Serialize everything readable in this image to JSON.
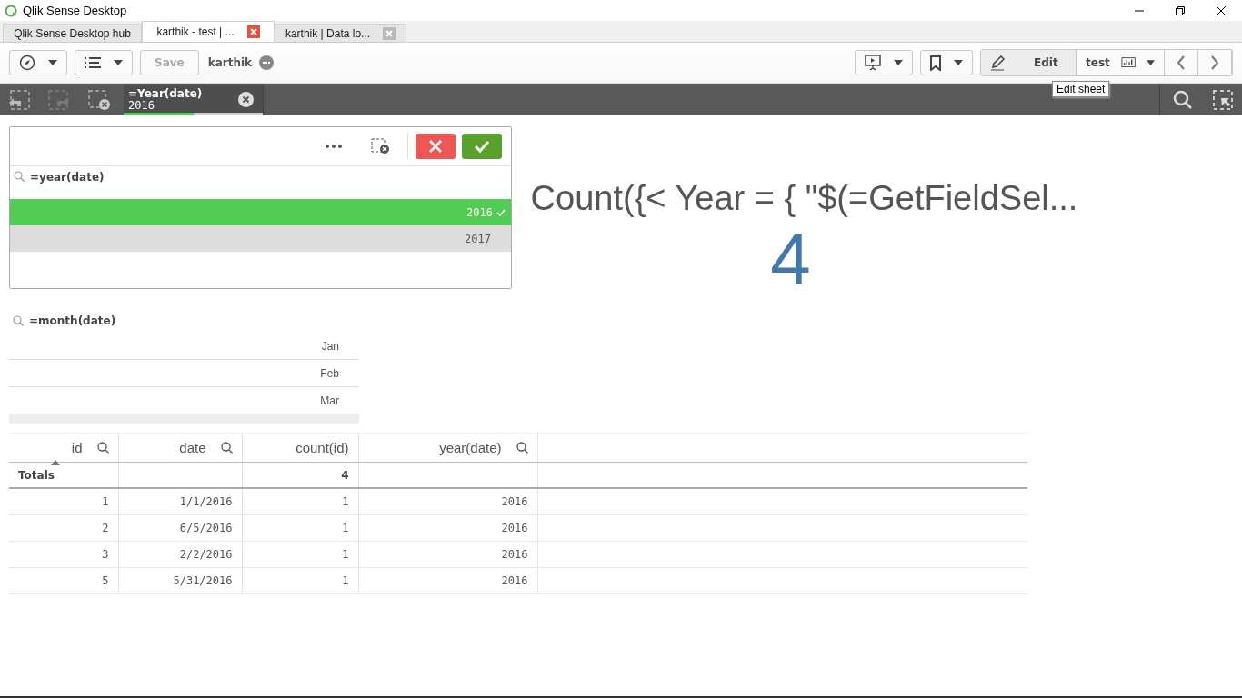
{
  "window": {
    "title": "Qlik Sense Desktop"
  },
  "tabs": [
    {
      "label": "Qlik Sense Desktop hub",
      "selected": false,
      "closable": false
    },
    {
      "label": "karthik - test | ...",
      "selected": true,
      "closable": true
    },
    {
      "label": "karthik | Data lo...",
      "selected": false,
      "closable": true
    }
  ],
  "toolbar": {
    "save_label": "Save",
    "save_disabled": true,
    "app_name": "karthik",
    "edit_label": "Edit",
    "sheet_name": "test",
    "tooltip": "Edit sheet"
  },
  "selection_bar": {
    "field": "=Year(date)",
    "value": "2016",
    "level": 0.5
  },
  "year_filter": {
    "title": "=year(date)",
    "items": [
      {
        "label": "2016",
        "selected": true
      },
      {
        "label": "2017",
        "selected": false,
        "alternative": true
      }
    ]
  },
  "kpi": {
    "title": "Count({< Year = { \"$(=GetFieldSel...",
    "value": "4"
  },
  "month_filter": {
    "title": "=month(date)",
    "items": [
      {
        "label": "Jan",
        "selected": false
      },
      {
        "label": "Feb",
        "selected": false
      },
      {
        "label": "Mar",
        "selected": false
      }
    ]
  },
  "table": {
    "totals_label": "Totals",
    "columns": [
      {
        "label": "id",
        "searchable": true,
        "sorted": true
      },
      {
        "label": "date",
        "searchable": true,
        "sorted": false
      },
      {
        "label": "count(id)",
        "searchable": false,
        "sorted": false,
        "total": "4"
      },
      {
        "label": "year(date)",
        "searchable": true,
        "sorted": false
      }
    ],
    "rows": [
      [
        "1",
        "1/1/2016",
        "1",
        "2016"
      ],
      [
        "2",
        "6/5/2016",
        "1",
        "2016"
      ],
      [
        "3",
        "2/2/2016",
        "1",
        "2016"
      ],
      [
        "5",
        "5/31/2016",
        "1",
        "2016"
      ]
    ]
  }
}
